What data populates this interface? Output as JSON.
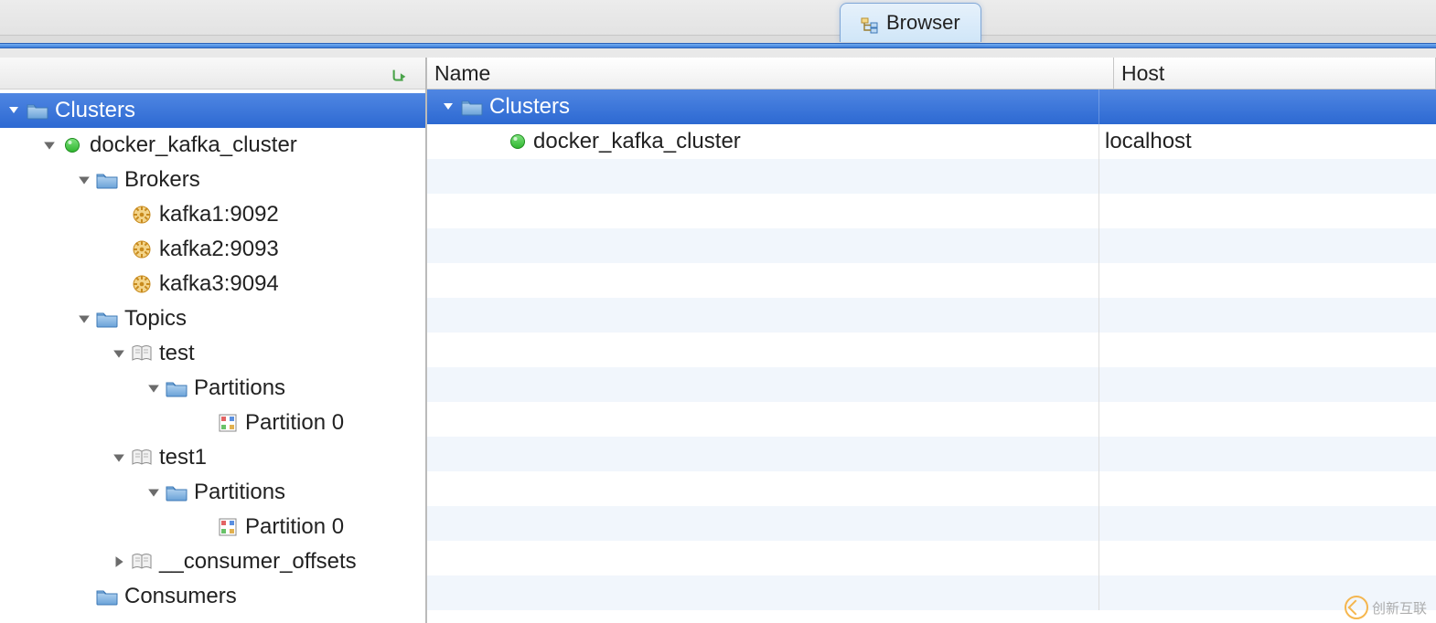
{
  "tab": {
    "label": "Browser"
  },
  "columns": {
    "name": "Name",
    "host": "Host"
  },
  "sidebar": {
    "root": {
      "label": "Clusters"
    },
    "cluster": {
      "label": "docker_kafka_cluster"
    },
    "brokers": {
      "label": "Brokers",
      "items": [
        {
          "label": "kafka1:9092"
        },
        {
          "label": "kafka2:9093"
        },
        {
          "label": "kafka3:9094"
        }
      ]
    },
    "topics": {
      "label": "Topics",
      "items": [
        {
          "label": "test",
          "partitions_label": "Partitions",
          "partitions": [
            {
              "label": "Partition 0"
            }
          ]
        },
        {
          "label": "test1",
          "partitions_label": "Partitions",
          "partitions": [
            {
              "label": "Partition 0"
            }
          ]
        },
        {
          "label": "__consumer_offsets"
        }
      ]
    },
    "consumers": {
      "label": "Consumers"
    }
  },
  "table": {
    "rows": [
      {
        "name": "Clusters",
        "host": ""
      },
      {
        "name": "docker_kafka_cluster",
        "host": "localhost"
      }
    ]
  },
  "watermark": {
    "label": "创新互联"
  }
}
